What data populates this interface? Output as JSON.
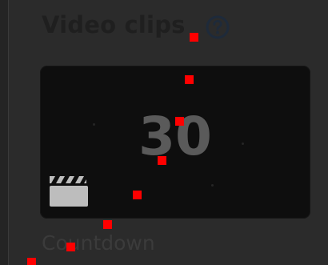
{
  "section": {
    "title": "Video clips",
    "help_icon": "question-circle-icon"
  },
  "card": {
    "countdown_value": "30",
    "icon": "clapperboard-icon",
    "caption": "Countdown"
  },
  "overlay": {
    "marker_color": "#ff0000"
  },
  "colors": {
    "background": "#2b2b2b",
    "card_background": "#0e0e0e",
    "title": "#1f1f1f"
  }
}
